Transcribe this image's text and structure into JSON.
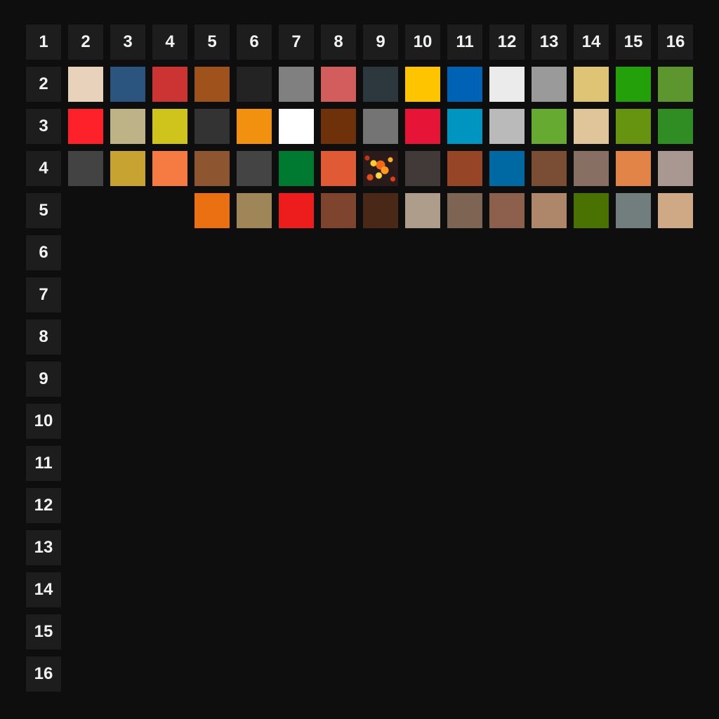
{
  "grid": {
    "column_headers": [
      "1",
      "2",
      "3",
      "4",
      "5",
      "6",
      "7",
      "8",
      "9",
      "10",
      "11",
      "12",
      "13",
      "14",
      "15",
      "16"
    ],
    "row_headers": [
      "2",
      "3",
      "4",
      "5",
      "6",
      "7",
      "8",
      "9",
      "10",
      "11",
      "12",
      "13",
      "14",
      "15",
      "16"
    ],
    "rows": [
      [
        "#e9d2bb",
        "#2b547e",
        "#cc3333",
        "#a0521c",
        "#232323",
        "#808080",
        "#d35c5c",
        "#2c373e",
        "#ffc400",
        "#0062b4",
        "#ebebeb",
        "#9a9a9a",
        "#e0c476",
        "#23a00a",
        "#5d952f"
      ],
      [
        "#ff2129",
        "#bdb386",
        "#cfc41c",
        "#333333",
        "#f29010",
        "#ffffff",
        "#6f310a",
        "#747474",
        "#e61437",
        "#0095c0",
        "#bababa",
        "#66aa32",
        "#e0c49a",
        "#669410",
        "#2f8d24"
      ],
      [
        "#434343",
        "#c7a332",
        "#f57b42",
        "#8d5630",
        "#444444",
        "#007a31",
        "#e05a36",
        "lava-pattern",
        "#423a38",
        "#974527",
        "#0068a2",
        "#7a4d35",
        "#876f63",
        "#e28448",
        "#a99891"
      ],
      [
        null,
        null,
        null,
        "#ea7012",
        "#9e8658",
        "#ee1d1d",
        "#7f442e",
        "#4a2818",
        "#ae9d8b",
        "#7d6453",
        "#8c604d",
        "#ae866a",
        "#4a7203",
        "#727e7e",
        "#cfa985"
      ]
    ]
  }
}
